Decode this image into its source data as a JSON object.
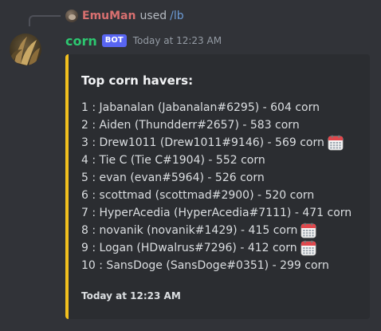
{
  "reply": {
    "username": "EmuMan",
    "used_text": "used",
    "command": "/lb"
  },
  "message": {
    "author": "corn",
    "bot_tag": "BOT",
    "timestamp": "Today at 12:23 AM"
  },
  "embed": {
    "accent_color": "#f2c01e",
    "title": "Top corn havers:",
    "rows": [
      {
        "text": "1 : Jabanalan (Jabanalan#6295) - 604 corn",
        "icon": ""
      },
      {
        "text": "2 : Aiden (Thundderr#2657) - 583 corn",
        "icon": ""
      },
      {
        "text": "3 : Drew1011 (Drew1011#9146) - 569 corn",
        "icon": "calendar-icon"
      },
      {
        "text": "4 : Tie C (Tie C#1904) - 552 corn",
        "icon": ""
      },
      {
        "text": "5 : evan (evan#5964) - 526 corn",
        "icon": ""
      },
      {
        "text": "6 : scottmad (scottmad#2900) - 520 corn",
        "icon": ""
      },
      {
        "text": "7 : HyperAcedia (HyperAcedia#7111) - 471 corn",
        "icon": ""
      },
      {
        "text": "8 : novanik (novanik#1429) - 415 corn",
        "icon": "calendar-icon"
      },
      {
        "text": "9 : Logan (HDwalrus#7296) - 412 corn",
        "icon": "calendar-icon"
      },
      {
        "text": "10 : SansDoge (SansDoge#0351) - 299 corn",
        "icon": ""
      }
    ],
    "footer_timestamp": "Today at 12:23 AM"
  }
}
